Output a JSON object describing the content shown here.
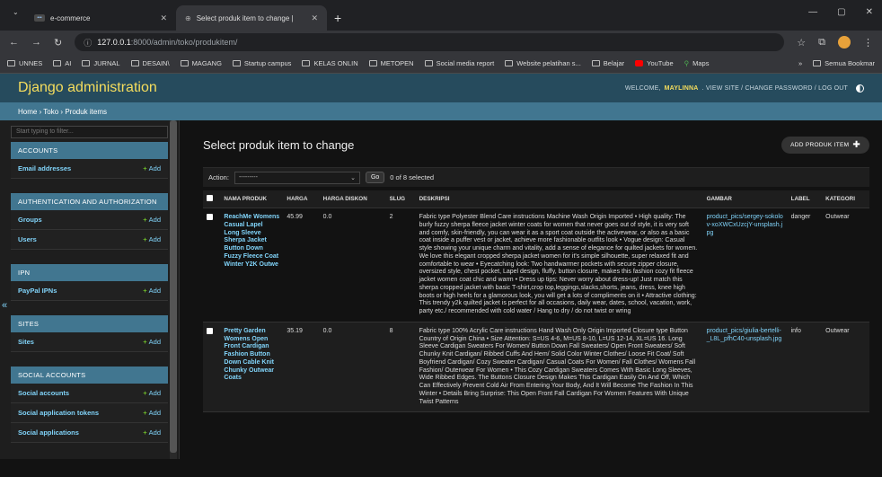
{
  "browser": {
    "tabs": [
      {
        "label": "e-commerce",
        "active": false
      },
      {
        "label": "Select produk item to change |",
        "active": true
      }
    ],
    "url_host": "127.0.0.1",
    "url_path": ":8000/admin/toko/produkitem/",
    "bookmarks": [
      "UNNES",
      "AI",
      "JURNAL",
      "DESAIN\\",
      "MAGANG",
      "Startup campus",
      "KELAS ONLIN",
      "METOPEN",
      "Social media report",
      "Website pelatihan s...",
      "Belajar",
      "YouTube",
      "Maps"
    ],
    "bookmarks_overflow": "»",
    "all_bookmarks": "Semua Bookmar"
  },
  "header": {
    "brand": "Django administration",
    "welcome": "WELCOME,",
    "username": "MAYLINNA",
    "user_links": ". VIEW SITE / CHANGE PASSWORD / LOG OUT"
  },
  "breadcrumb": "Home › Toko › Produk items",
  "sidebar": {
    "filter_placeholder": "Start typing to filter...",
    "modules": [
      {
        "caption": "ACCOUNTS",
        "rows": [
          {
            "label": "Email addresses",
            "add": "Add"
          }
        ]
      },
      {
        "caption": "AUTHENTICATION AND AUTHORIZATION",
        "rows": [
          {
            "label": "Groups",
            "add": "Add"
          },
          {
            "label": "Users",
            "add": "Add"
          }
        ]
      },
      {
        "caption": "IPN",
        "rows": [
          {
            "label": "PayPal IPNs",
            "add": "Add"
          }
        ]
      },
      {
        "caption": "SITES",
        "rows": [
          {
            "label": "Sites",
            "add": "Add"
          }
        ]
      },
      {
        "caption": "SOCIAL ACCOUNTS",
        "rows": [
          {
            "label": "Social accounts",
            "add": "Add"
          },
          {
            "label": "Social application tokens",
            "add": "Add"
          },
          {
            "label": "Social applications",
            "add": "Add"
          }
        ]
      }
    ],
    "collapse_glyph": "«"
  },
  "main": {
    "title": "Select produk item to change",
    "add_button": "ADD PRODUK ITEM",
    "action_label": "Action:",
    "action_select": "---------",
    "go_label": "Go",
    "selected_count": "0 of 8 selected",
    "columns": [
      "NAMA PRODUK",
      "HARGA",
      "HARGA DISKON",
      "SLUG",
      "DESKRIPSI",
      "GAMBAR",
      "LABEL",
      "KATEGORI"
    ],
    "rows": [
      {
        "nama": "ReachMe Womens Casual Lapel Long Sleeve Sherpa Jacket Button Down Fuzzy Fleece Coat Winter Y2K Outwe",
        "harga": "45.99",
        "diskon": "0.0",
        "slug": "2",
        "deskripsi": "Fabric type Polyester Blend Care instructions Machine Wash Origin Imported • High quality: The burly fuzzy sherpa fleece jacket winter coats for women that never goes out of style, it is very soft and comfy, skin-friendly, you can wear it as a sport coat outside the activewear, or also as a basic coat inside a puffer vest or jacket, achieve more fashionable outfits look • Vogue design: Casual style showing your unique charm and vitality, add a sense of elegance for quilted jackets for women. We love this elegant cropped sherpa jacket women for it's simple silhouette, super relaxed fit and comfortable to wear • Eyecatching look: Two handwarmer pockets with secure zipper closure, oversized style, chest pocket, Lapel design, fluffy, button closure, makes this fashion cozy fit fleece jacket women coat chic and warm • Dress up tips: Never worry about dress-up! Just match this sherpa cropped jacket with basic T-shirt,crop top,leggings,slacks,shorts, jeans, dress, knee high boots or high heels for a glamorous look, you will get a lots of compliments on it • Attractive clothing: This trendy y2k quilted jacket is perfect for all occasions, daily wear, dates, school, vacation, work, party etc./ recommended with cold water / Hang to dry / do not twist or wring",
        "gambar": "product_pics/sergey-sokolov-xoXWCxUzcjY-unsplash.jpg",
        "label": "danger",
        "kategori": "Outwear"
      },
      {
        "nama": "Pretty Garden Womens Open Front Cardigan Fashion Button Down Cable Knit Chunky Outwear Coats",
        "harga": "35.19",
        "diskon": "0.0",
        "slug": "8",
        "deskripsi": "Fabric type 100% Acrylic Care instructions Hand Wash Only Origin Imported Closure type Button Country of Origin China • Size Attention: S=US 4-6, M=US 8-10, L=US 12-14, XL=US 16. Long Sleeve Cardigan Sweaters For Women/ Button Down Fall Sweaters/ Open Front Sweaters/ Soft Chunky Knit Cardigan/ Ribbed Cuffs And Hem/ Solid Color Winter Clothes/ Loose Fit Coat/ Soft Boyfriend Cardigan/ Cozy Sweater Cardigan/ Casual Coats For Women/ Fall Clothes/ Womens Fall Fashion/ Outerwear For Women • This Cozy Cardigan Sweaters Comes With Basic Long Sleeves, Wide Ribbed Edges. The Buttons Closure Design Makes This Cardigan Easily On And Off, Which Can Effectively Prevent Cold Air From Entering Your Body, And It Will Become The Fashion In This Winter • Details Bring Surprise: This Open Front Fall Cardigan For Women Features With Unique Twist Patterns",
        "gambar": "product_pics/giulia-bertelli-_L8L_pfhC40-unsplash.jpg",
        "label": "info",
        "kategori": "Outwear"
      }
    ]
  }
}
